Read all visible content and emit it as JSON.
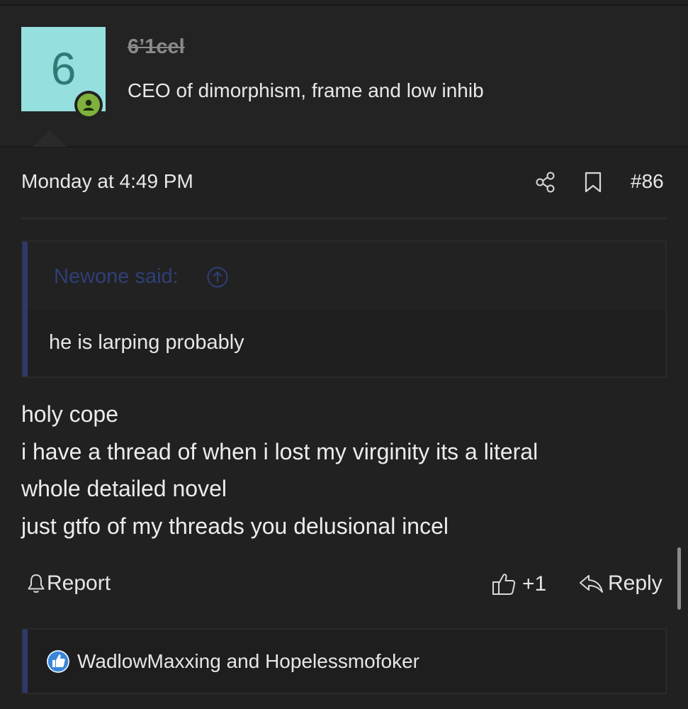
{
  "user": {
    "avatar_letter": "6",
    "avatar_color": "#95e0df",
    "username": "6’1cel",
    "title": "CEO of dimorphism, frame and low inhib",
    "status_icon": "online-person-icon"
  },
  "post": {
    "date": "Monday at 4:49 PM",
    "number": "#86",
    "meta_icons": [
      "share-icon",
      "bookmark-icon"
    ],
    "quote": {
      "author_label": "Newone said:",
      "text": "he is larping probably"
    },
    "body_lines": [
      "holy cope",
      "i have a thread of when i lost my virginity its a literal",
      "whole detailed novel",
      "just gtfo of my threads you delusional incel"
    ]
  },
  "actions": {
    "report_label": "Report",
    "like_label": "+1",
    "reply_label": "Reply"
  },
  "reactions": {
    "icon": "like-reaction-icon",
    "text": "WadlowMaxxing and Hopelessmofoker"
  },
  "colors": {
    "background": "#212121",
    "quote_accent": "#2e3a6e",
    "online": "#7fb23c"
  }
}
